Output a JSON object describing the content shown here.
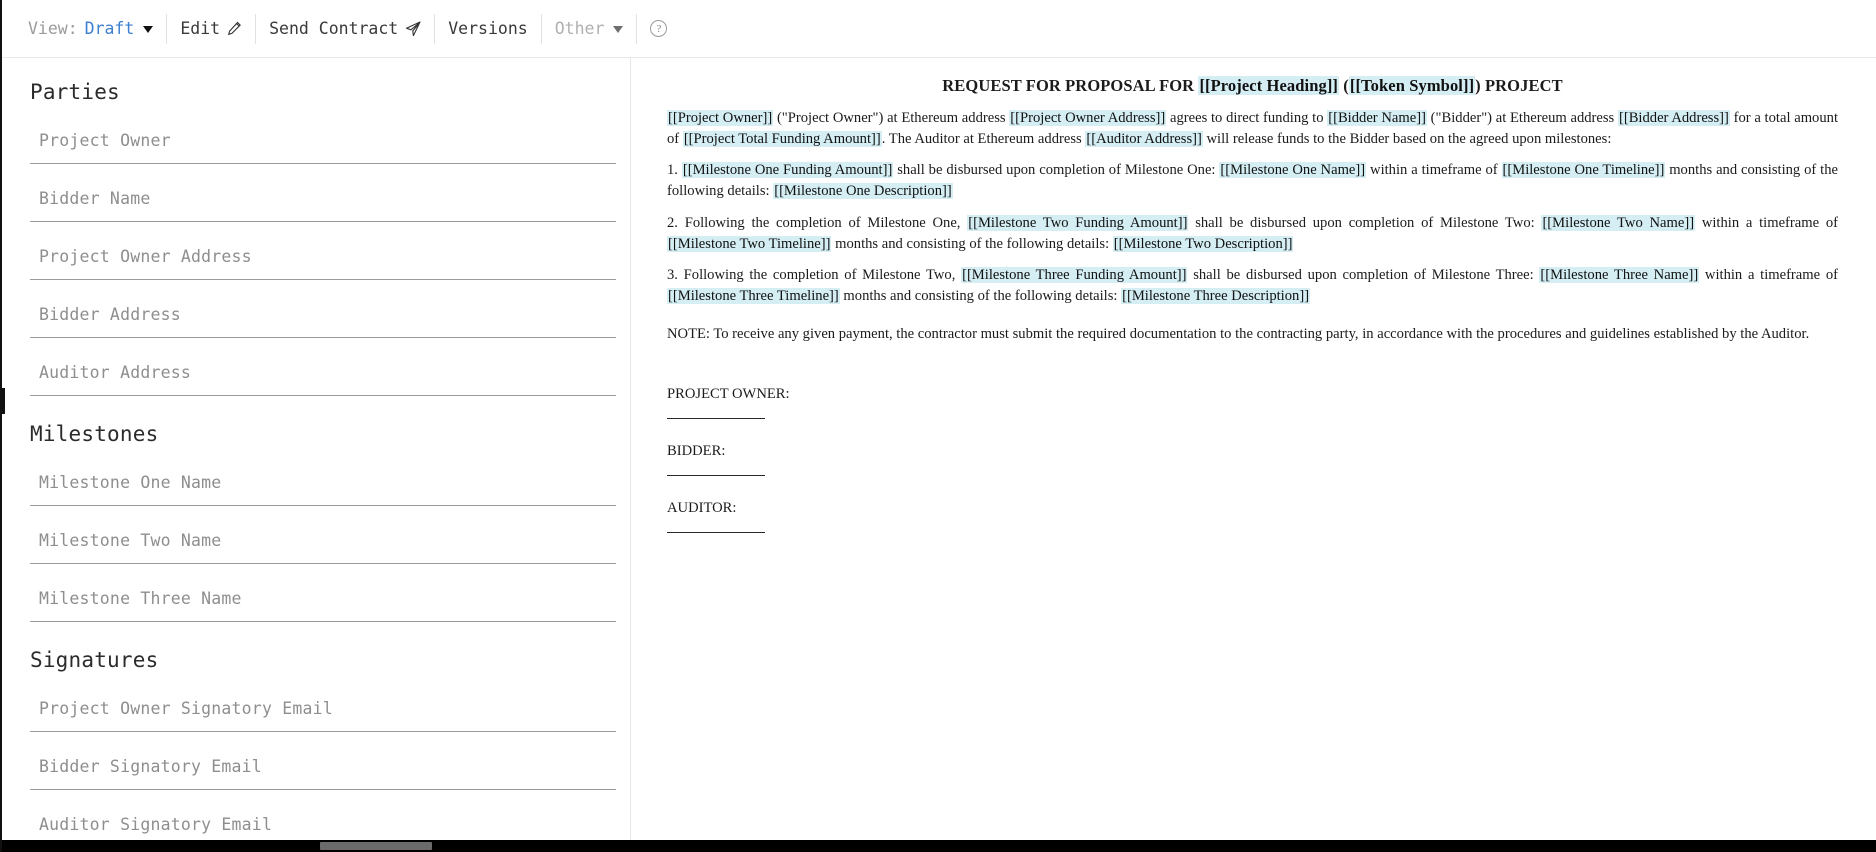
{
  "toolbar": {
    "view_label": "View:",
    "view_value": "Draft",
    "edit_label": "Edit",
    "edit_icon": "pencil-icon",
    "send_contract_label": "Send Contract",
    "send_icon": "paper-plane-icon",
    "versions_label": "Versions",
    "other_label": "Other",
    "help_label": "?",
    "accent_color": "#3d7fd1",
    "muted_color": "#b0b0b0"
  },
  "sidebar": {
    "sections": [
      {
        "title": "Parties",
        "fields": [
          {
            "placeholder": "Project Owner",
            "value": ""
          },
          {
            "placeholder": "Bidder Name",
            "value": ""
          },
          {
            "placeholder": "Project Owner Address",
            "value": ""
          },
          {
            "placeholder": "Bidder Address",
            "value": ""
          },
          {
            "placeholder": "Auditor Address",
            "value": ""
          }
        ]
      },
      {
        "title": "Milestones",
        "fields": [
          {
            "placeholder": "Milestone One Name",
            "value": ""
          },
          {
            "placeholder": "Milestone Two Name",
            "value": ""
          },
          {
            "placeholder": "Milestone Three Name",
            "value": ""
          }
        ]
      },
      {
        "title": "Signatures",
        "fields": [
          {
            "placeholder": "Project Owner Signatory Email",
            "value": ""
          },
          {
            "placeholder": "Bidder Signatory Email",
            "value": ""
          },
          {
            "placeholder": "Auditor Signatory Email",
            "value": ""
          }
        ]
      }
    ]
  },
  "document": {
    "title_part_1": "REQUEST FOR PROPOSAL FOR ",
    "title_var_1": "[[Project Heading]]",
    "title_part_2": " (",
    "title_var_2": "[[Token Symbol]]",
    "title_part_3": ") PROJECT",
    "paragraph_1": {
      "v1": "[[Project Owner]]",
      "t1": " (\"Project Owner\") at Ethereum address ",
      "v2": "[[Project Owner Address]]",
      "t2": " agrees to direct funding to ",
      "v3": "[[Bidder Name]]",
      "t3": " (\"Bidder\") at Ethereum address ",
      "v4": "[[Bidder Address]]",
      "t4": " for a total amount of ",
      "v5": "[[Project Total Funding Amount]]",
      "t5": ". The Auditor at Ethereum address ",
      "v6": "[[Auditor Address]]",
      "t6": " will release funds to the Bidder based on the agreed upon milestones:"
    },
    "paragraph_2": {
      "t0": "1. ",
      "v1": "[[Milestone One Funding Amount]]",
      "t1": " shall be disbursed upon completion of Milestone One: ",
      "v2": "[[Milestone One Name]]",
      "t2": " within a timeframe of ",
      "v3": "[[Milestone One Timeline]]",
      "t3": " months and consisting of the following details: ",
      "v4": "[[Milestone One Description]]"
    },
    "paragraph_3": {
      "t0": "2. Following the completion of Milestone One, ",
      "v1": "[[Milestone Two Funding Amount]]",
      "t1": " shall be disbursed upon completion of Milestone Two: ",
      "v2": "[[Milestone Two Name]]",
      "t2": " within a timeframe of ",
      "v3": "[[Milestone Two Timeline]]",
      "t3": " months and consisting of the following details: ",
      "v4": "[[Milestone Two Description]]"
    },
    "paragraph_4": {
      "t0": "3. Following the completion of Milestone Two, ",
      "v1": "[[Milestone Three Funding Amount]]",
      "t1": " shall be disbursed upon completion of Milestone Three: ",
      "v2": "[[Milestone Three Name]]",
      "t2": " within a timeframe of ",
      "v3": "[[Milestone Three Timeline]]",
      "t3": " months and consisting of the following details: ",
      "v4": "[[Milestone Three Description]]"
    },
    "note": "NOTE: To receive any given payment, the contractor must submit the required documentation to the contracting party, in accordance with the procedures and guidelines established by the Auditor.",
    "signatures": [
      {
        "label": "PROJECT OWNER:"
      },
      {
        "label": "BIDDER:"
      },
      {
        "label": "AUDITOR:"
      }
    ],
    "highlight_color": "#d4eef4"
  }
}
